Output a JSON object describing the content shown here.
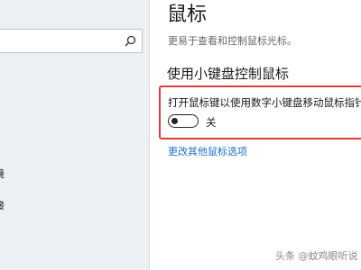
{
  "sidebar": {
    "search": {
      "value": "",
      "icon": "search-icon"
    },
    "items": [
      {
        "label": "境"
      },
      {
        "label": "接"
      }
    ]
  },
  "main": {
    "title": "鼠标",
    "description": "更易于查看和控制鼠标光标。",
    "section_title": "使用小键盘控制鼠标",
    "setting": {
      "label": "打开鼠标键以使用数字小键盘移动鼠标指针",
      "toggle_state": "关",
      "toggle_on": false
    },
    "more_link": "更改其他鼠标选项"
  },
  "colors": {
    "highlight": "#e03a3a",
    "link": "#1a6fc9",
    "sidebar_bg": "#eaf0f3"
  },
  "watermark": "头条 @蚊鸡眼听说"
}
